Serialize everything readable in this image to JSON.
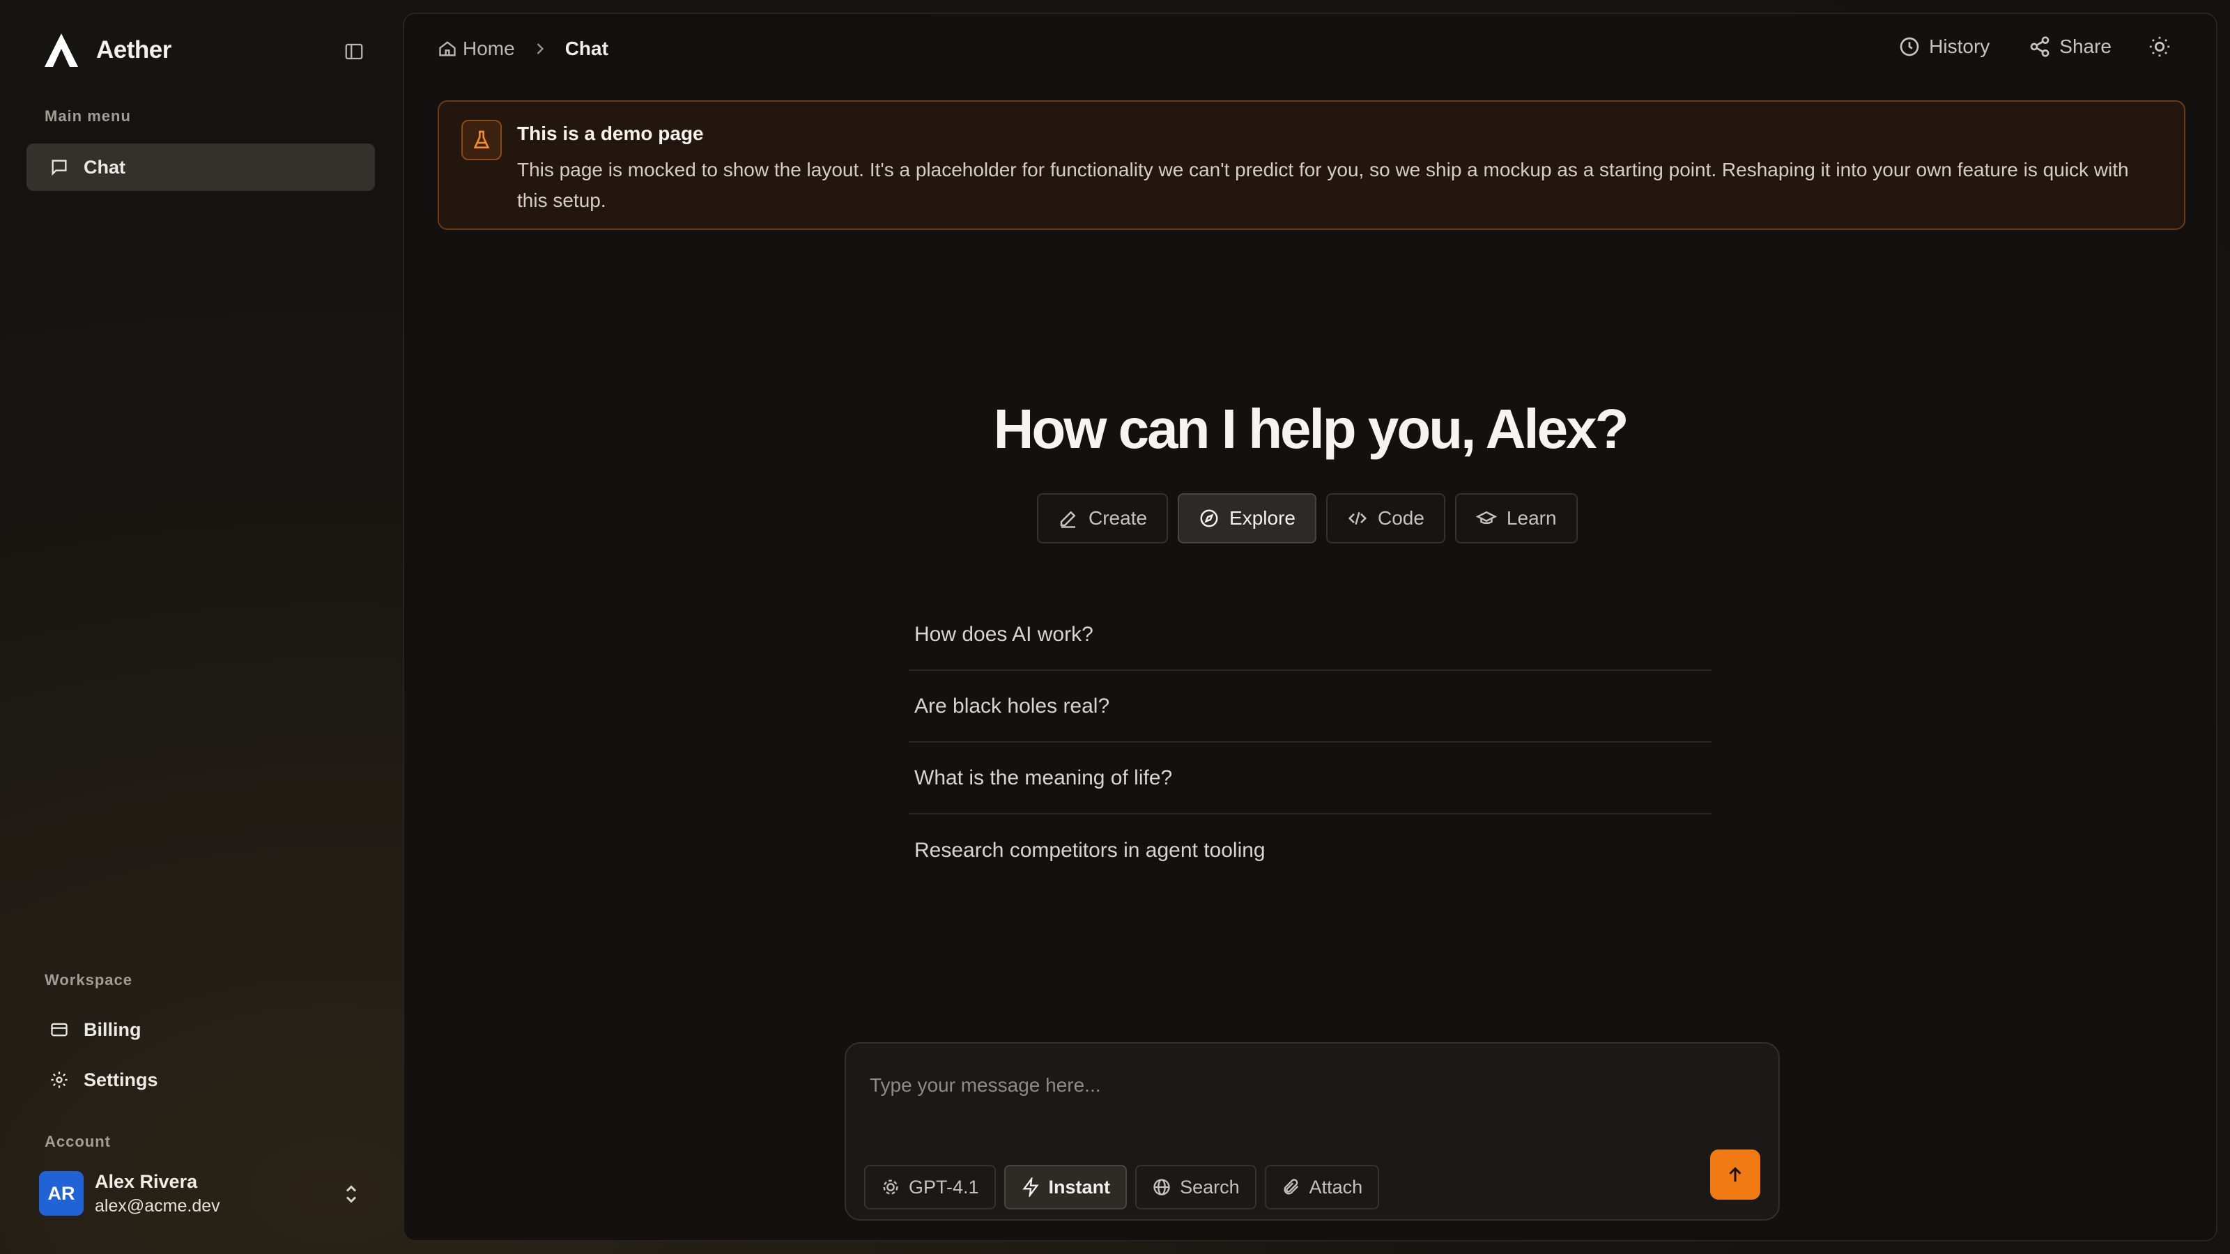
{
  "app": {
    "name": "Aether"
  },
  "colors": {
    "accent": "#f27a12",
    "avatar": "#1f63d6",
    "banner_border": "#6b3a16"
  },
  "sidebar": {
    "main_menu_label": "Main menu",
    "main_items": [
      {
        "label": "Chat",
        "icon": "chat-icon",
        "active": true
      }
    ],
    "workspace_label": "Workspace",
    "workspace_items": [
      {
        "label": "Billing",
        "icon": "credit-card-icon"
      },
      {
        "label": "Settings",
        "icon": "gear-icon"
      }
    ],
    "account_label": "Account",
    "account": {
      "initials": "AR",
      "name": "Alex Rivera",
      "email": "alex@acme.dev"
    }
  },
  "header": {
    "breadcrumb": {
      "home": "Home",
      "current": "Chat"
    },
    "actions": {
      "history": "History",
      "share": "Share"
    }
  },
  "banner": {
    "title": "This is a demo page",
    "body": "This page is mocked to show the layout. It's a placeholder for functionality we can't predict for you, so we ship a mockup as a starting point. Reshaping it into your own feature is quick with this setup."
  },
  "hero": {
    "greeting": "How can I help you, Alex?"
  },
  "modes": [
    {
      "label": "Create",
      "icon": "pencil-icon",
      "active": false
    },
    {
      "label": "Explore",
      "icon": "compass-icon",
      "active": true
    },
    {
      "label": "Code",
      "icon": "code-icon",
      "active": false
    },
    {
      "label": "Learn",
      "icon": "graduation-cap-icon",
      "active": false
    }
  ],
  "suggestions": [
    "How does AI work?",
    "Are black holes real?",
    "What is the meaning of life?",
    "Research competitors in agent tooling"
  ],
  "composer": {
    "placeholder": "Type your message here...",
    "model": "GPT-4.1",
    "instant": "Instant",
    "search": "Search",
    "attach": "Attach"
  }
}
